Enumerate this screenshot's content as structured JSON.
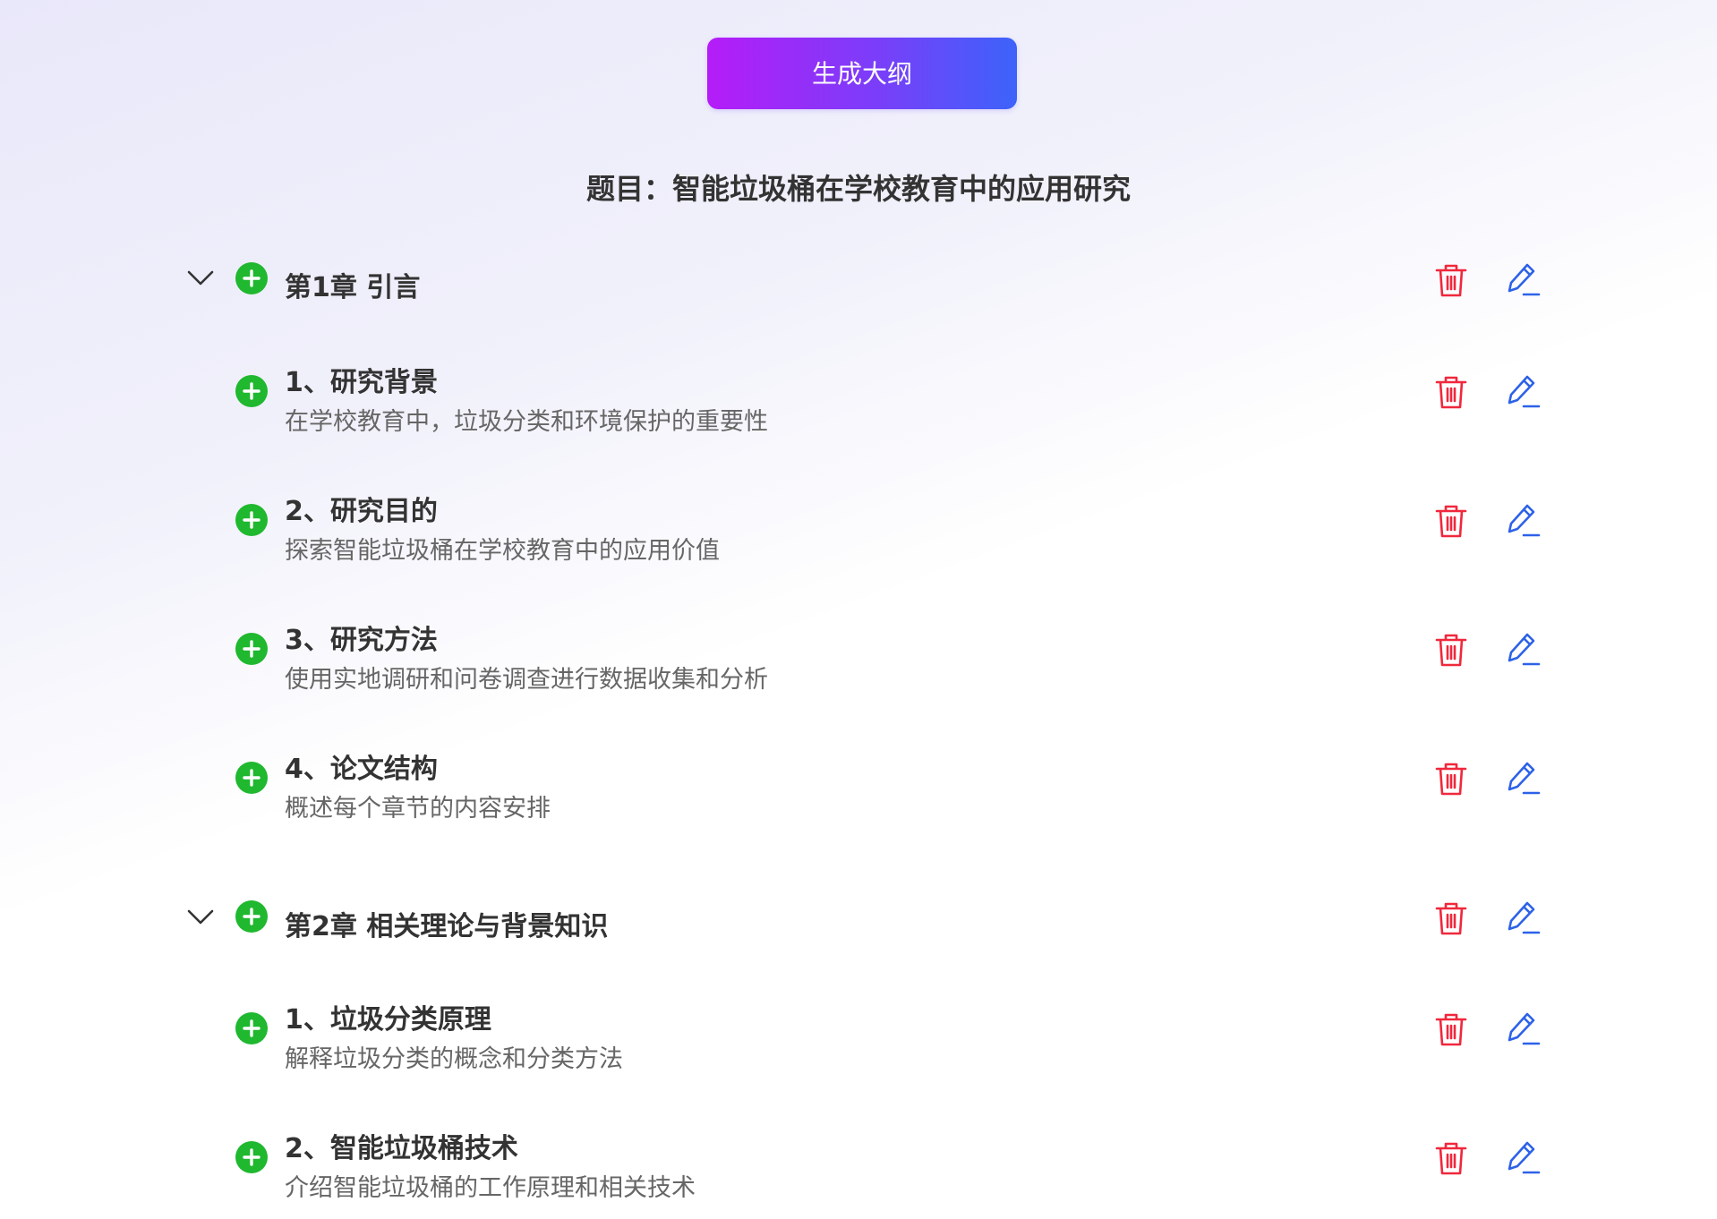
{
  "generate_button": {
    "label": "生成大纲"
  },
  "title": "题目：智能垃圾桶在学校教育中的应用研究",
  "colors": {
    "add": "#1fb82f",
    "delete": "#f0283c",
    "edit": "#2d62e8",
    "button_gradient_start": "#b51cf7",
    "button_gradient_end": "#3c63fa"
  },
  "chapters": [
    {
      "title": "第1章 引言",
      "sections": [
        {
          "title": "1、研究背景",
          "desc": "在学校教育中，垃圾分类和环境保护的重要性"
        },
        {
          "title": "2、研究目的",
          "desc": "探索智能垃圾桶在学校教育中的应用价值"
        },
        {
          "title": "3、研究方法",
          "desc": "使用实地调研和问卷调查进行数据收集和分析"
        },
        {
          "title": "4、论文结构",
          "desc": "概述每个章节的内容安排"
        }
      ]
    },
    {
      "title": "第2章 相关理论与背景知识",
      "sections": [
        {
          "title": "1、垃圾分类原理",
          "desc": "解释垃圾分类的概念和分类方法"
        },
        {
          "title": "2、智能垃圾桶技术",
          "desc": "介绍智能垃圾桶的工作原理和相关技术"
        }
      ]
    }
  ]
}
